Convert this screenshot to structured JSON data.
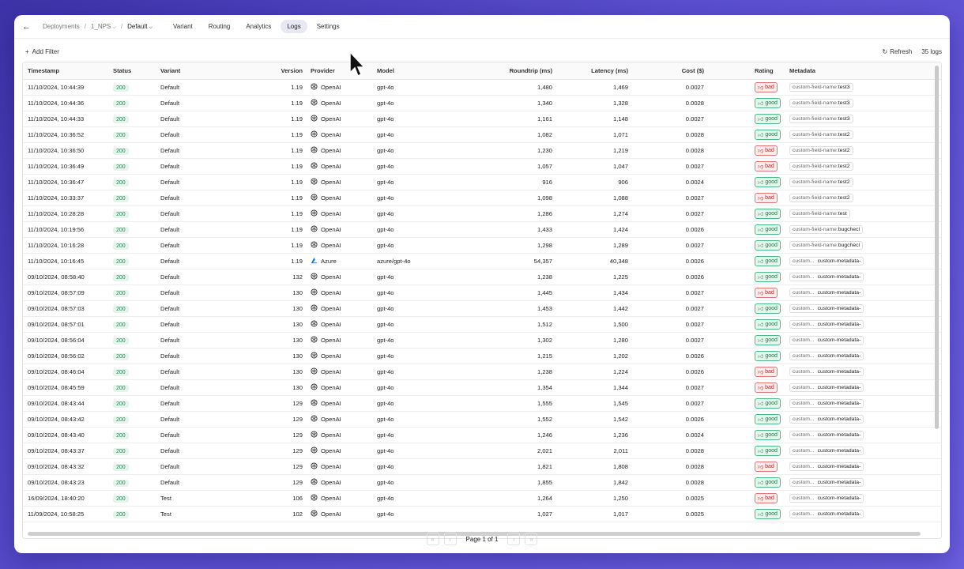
{
  "nav": {
    "crumbs": [
      "Deployments",
      "1_NPS",
      "Default"
    ],
    "tabs": [
      "Variant",
      "Routing",
      "Analytics",
      "Logs",
      "Settings"
    ],
    "active_tab": "Logs"
  },
  "toolbar": {
    "add_filter": "Add Filter",
    "refresh": "Refresh",
    "logs_count": "35 logs"
  },
  "table": {
    "headers": [
      "Timestamp",
      "Status",
      "Variant",
      "Version",
      "Provider",
      "Model",
      "Roundtrip (ms)",
      "Latency (ms)",
      "Cost ($)",
      "Rating",
      "Metadata"
    ],
    "rows": [
      {
        "ts": "11/10/2024, 10:44:39",
        "status": "200",
        "variant": "Default",
        "version": "1.19",
        "provider": "OpenAI",
        "model": "gpt-4o",
        "roundtrip": "1,480",
        "latency": "1,469",
        "cost": "0.0027",
        "rating": "bad",
        "meta_key": "custom-field-name:",
        "meta_val": "test3"
      },
      {
        "ts": "11/10/2024, 10:44:36",
        "status": "200",
        "variant": "Default",
        "version": "1.19",
        "provider": "OpenAI",
        "model": "gpt-4o",
        "roundtrip": "1,340",
        "latency": "1,328",
        "cost": "0.0028",
        "rating": "good",
        "meta_key": "custom-field-name:",
        "meta_val": "test3"
      },
      {
        "ts": "11/10/2024, 10:44:33",
        "status": "200",
        "variant": "Default",
        "version": "1.19",
        "provider": "OpenAI",
        "model": "gpt-4o",
        "roundtrip": "1,161",
        "latency": "1,148",
        "cost": "0.0027",
        "rating": "good",
        "meta_key": "custom-field-name:",
        "meta_val": "test3"
      },
      {
        "ts": "11/10/2024, 10:36:52",
        "status": "200",
        "variant": "Default",
        "version": "1.19",
        "provider": "OpenAI",
        "model": "gpt-4o",
        "roundtrip": "1,082",
        "latency": "1,071",
        "cost": "0.0028",
        "rating": "good",
        "meta_key": "custom-field-name:",
        "meta_val": "test2"
      },
      {
        "ts": "11/10/2024, 10:36:50",
        "status": "200",
        "variant": "Default",
        "version": "1.19",
        "provider": "OpenAI",
        "model": "gpt-4o",
        "roundtrip": "1,230",
        "latency": "1,219",
        "cost": "0.0028",
        "rating": "bad",
        "meta_key": "custom-field-name:",
        "meta_val": "test2"
      },
      {
        "ts": "11/10/2024, 10:36:49",
        "status": "200",
        "variant": "Default",
        "version": "1.19",
        "provider": "OpenAI",
        "model": "gpt-4o",
        "roundtrip": "1,057",
        "latency": "1,047",
        "cost": "0.0027",
        "rating": "bad",
        "meta_key": "custom-field-name:",
        "meta_val": "test2"
      },
      {
        "ts": "11/10/2024, 10:36:47",
        "status": "200",
        "variant": "Default",
        "version": "1.19",
        "provider": "OpenAI",
        "model": "gpt-4o",
        "roundtrip": "916",
        "latency": "906",
        "cost": "0.0024",
        "rating": "good",
        "meta_key": "custom-field-name:",
        "meta_val": "test2"
      },
      {
        "ts": "11/10/2024, 10:33:37",
        "status": "200",
        "variant": "Default",
        "version": "1.19",
        "provider": "OpenAI",
        "model": "gpt-4o",
        "roundtrip": "1,098",
        "latency": "1,088",
        "cost": "0.0027",
        "rating": "bad",
        "meta_key": "custom-field-name:",
        "meta_val": "test2"
      },
      {
        "ts": "11/10/2024, 10:28:28",
        "status": "200",
        "variant": "Default",
        "version": "1.19",
        "provider": "OpenAI",
        "model": "gpt-4o",
        "roundtrip": "1,286",
        "latency": "1,274",
        "cost": "0.0027",
        "rating": "good",
        "meta_key": "custom-field-name:",
        "meta_val": "test"
      },
      {
        "ts": "11/10/2024, 10:19:56",
        "status": "200",
        "variant": "Default",
        "version": "1.19",
        "provider": "OpenAI",
        "model": "gpt-4o",
        "roundtrip": "1,433",
        "latency": "1,424",
        "cost": "0.0026",
        "rating": "good",
        "meta_key": "custom-field-name:",
        "meta_val": "bugchecl"
      },
      {
        "ts": "11/10/2024, 10:16:28",
        "status": "200",
        "variant": "Default",
        "version": "1.19",
        "provider": "OpenAI",
        "model": "gpt-4o",
        "roundtrip": "1,298",
        "latency": "1,289",
        "cost": "0.0027",
        "rating": "good",
        "meta_key": "custom-field-name:",
        "meta_val": "bugchecl"
      },
      {
        "ts": "11/10/2024, 10:16:45",
        "status": "200",
        "variant": "Default",
        "version": "1.19",
        "provider": "Azure",
        "model": "azure/gpt-4o",
        "roundtrip": "54,357",
        "latency": "40,348",
        "cost": "0.0026",
        "rating": "good",
        "meta_key": "custom...",
        "meta_val": "custom-metadata-"
      },
      {
        "ts": "09/10/2024, 08:58:40",
        "status": "200",
        "variant": "Default",
        "version": "132",
        "provider": "OpenAI",
        "model": "gpt-4o",
        "roundtrip": "1,238",
        "latency": "1,225",
        "cost": "0.0026",
        "rating": "good",
        "meta_key": "custom...",
        "meta_val": "custom-metadata-"
      },
      {
        "ts": "09/10/2024, 08:57:09",
        "status": "200",
        "variant": "Default",
        "version": "130",
        "provider": "OpenAI",
        "model": "gpt-4o",
        "roundtrip": "1,445",
        "latency": "1,434",
        "cost": "0.0027",
        "rating": "bad",
        "meta_key": "custom...",
        "meta_val": "custom-metadata-"
      },
      {
        "ts": "09/10/2024, 08:57:03",
        "status": "200",
        "variant": "Default",
        "version": "130",
        "provider": "OpenAI",
        "model": "gpt-4o",
        "roundtrip": "1,453",
        "latency": "1,442",
        "cost": "0.0027",
        "rating": "good",
        "meta_key": "custom...",
        "meta_val": "custom-metadata-"
      },
      {
        "ts": "09/10/2024, 08:57:01",
        "status": "200",
        "variant": "Default",
        "version": "130",
        "provider": "OpenAI",
        "model": "gpt-4o",
        "roundtrip": "1,512",
        "latency": "1,500",
        "cost": "0.0027",
        "rating": "good",
        "meta_key": "custom...",
        "meta_val": "custom-metadata-"
      },
      {
        "ts": "09/10/2024, 08:56:04",
        "status": "200",
        "variant": "Default",
        "version": "130",
        "provider": "OpenAI",
        "model": "gpt-4o",
        "roundtrip": "1,302",
        "latency": "1,280",
        "cost": "0.0027",
        "rating": "good",
        "meta_key": "custom...",
        "meta_val": "custom-metadata-"
      },
      {
        "ts": "09/10/2024, 08:56:02",
        "status": "200",
        "variant": "Default",
        "version": "130",
        "provider": "OpenAI",
        "model": "gpt-4o",
        "roundtrip": "1,215",
        "latency": "1,202",
        "cost": "0.0026",
        "rating": "good",
        "meta_key": "custom...",
        "meta_val": "custom-metadata-"
      },
      {
        "ts": "09/10/2024, 08:46:04",
        "status": "200",
        "variant": "Default",
        "version": "130",
        "provider": "OpenAI",
        "model": "gpt-4o",
        "roundtrip": "1,238",
        "latency": "1,224",
        "cost": "0.0026",
        "rating": "bad",
        "meta_key": "custom...",
        "meta_val": "custom-metadata-"
      },
      {
        "ts": "09/10/2024, 08:45:59",
        "status": "200",
        "variant": "Default",
        "version": "130",
        "provider": "OpenAI",
        "model": "gpt-4o",
        "roundtrip": "1,354",
        "latency": "1,344",
        "cost": "0.0027",
        "rating": "bad",
        "meta_key": "custom...",
        "meta_val": "custom-metadata-"
      },
      {
        "ts": "09/10/2024, 08:43:44",
        "status": "200",
        "variant": "Default",
        "version": "129",
        "provider": "OpenAI",
        "model": "gpt-4o",
        "roundtrip": "1,555",
        "latency": "1,545",
        "cost": "0.0027",
        "rating": "good",
        "meta_key": "custom...",
        "meta_val": "custom-metadata-"
      },
      {
        "ts": "09/10/2024, 08:43:42",
        "status": "200",
        "variant": "Default",
        "version": "129",
        "provider": "OpenAI",
        "model": "gpt-4o",
        "roundtrip": "1,552",
        "latency": "1,542",
        "cost": "0.0026",
        "rating": "good",
        "meta_key": "custom...",
        "meta_val": "custom-metadata-"
      },
      {
        "ts": "09/10/2024, 08:43:40",
        "status": "200",
        "variant": "Default",
        "version": "129",
        "provider": "OpenAI",
        "model": "gpt-4o",
        "roundtrip": "1,246",
        "latency": "1,236",
        "cost": "0.0024",
        "rating": "good",
        "meta_key": "custom...",
        "meta_val": "custom-metadata-"
      },
      {
        "ts": "09/10/2024, 08:43:37",
        "status": "200",
        "variant": "Default",
        "version": "129",
        "provider": "OpenAI",
        "model": "gpt-4o",
        "roundtrip": "2,021",
        "latency": "2,011",
        "cost": "0.0028",
        "rating": "good",
        "meta_key": "custom...",
        "meta_val": "custom-metadata-"
      },
      {
        "ts": "09/10/2024, 08:43:32",
        "status": "200",
        "variant": "Default",
        "version": "129",
        "provider": "OpenAI",
        "model": "gpt-4o",
        "roundtrip": "1,821",
        "latency": "1,808",
        "cost": "0.0028",
        "rating": "bad",
        "meta_key": "custom...",
        "meta_val": "custom-metadata-"
      },
      {
        "ts": "09/10/2024, 08:43:23",
        "status": "200",
        "variant": "Default",
        "version": "129",
        "provider": "OpenAI",
        "model": "gpt-4o",
        "roundtrip": "1,855",
        "latency": "1,842",
        "cost": "0.0028",
        "rating": "good",
        "meta_key": "custom...",
        "meta_val": "custom-metadata-"
      },
      {
        "ts": "16/09/2024, 18:40:20",
        "status": "200",
        "variant": "Test",
        "version": "106",
        "provider": "OpenAI",
        "model": "gpt-4o",
        "roundtrip": "1,264",
        "latency": "1,250",
        "cost": "0.0025",
        "rating": "bad",
        "meta_key": "custom...",
        "meta_val": "custom-metadata-"
      },
      {
        "ts": "11/09/2024, 10:58:25",
        "status": "200",
        "variant": "Test",
        "version": "102",
        "provider": "OpenAI",
        "model": "gpt-4o",
        "roundtrip": "1,027",
        "latency": "1,017",
        "cost": "0.0025",
        "rating": "good",
        "meta_key": "custom...",
        "meta_val": "custom-metadata-"
      }
    ]
  },
  "pagination": {
    "label": "Page 1 of 1"
  },
  "colors": {
    "accent_good": "#177a45",
    "accent_bad": "#b42a2a",
    "status_bg": "#e4f6ec"
  }
}
